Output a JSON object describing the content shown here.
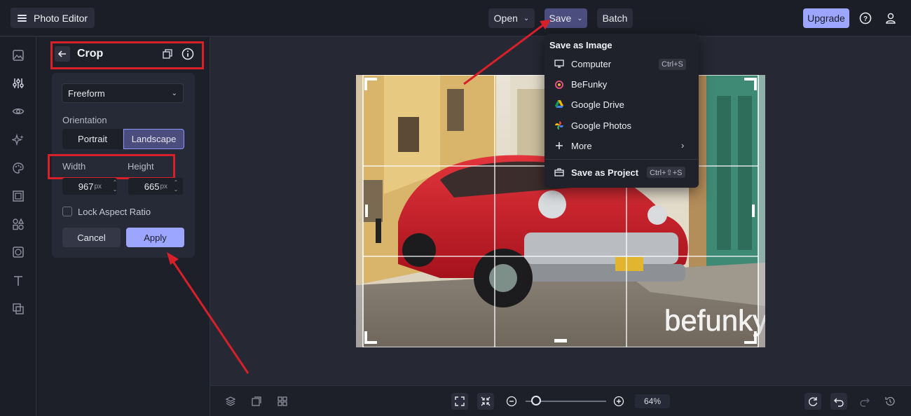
{
  "app": {
    "title": "Photo Editor"
  },
  "toolbar": {
    "open_label": "Open",
    "save_label": "Save",
    "batch_label": "Batch",
    "upgrade_label": "Upgrade"
  },
  "sidebar": {
    "icons": [
      "image-icon",
      "sliders-icon",
      "eye-icon",
      "sparkles-icon",
      "palette-icon",
      "frame-icon",
      "shapes-icon",
      "texture-icon",
      "text-icon",
      "layers-icon"
    ]
  },
  "crop_panel": {
    "title": "Crop",
    "ratio_selected": "Freeform",
    "orientation_label": "Orientation",
    "portrait_label": "Portrait",
    "landscape_label": "Landscape",
    "width_label": "Width",
    "height_label": "Height",
    "width_value": "967",
    "height_value": "665",
    "unit": "px",
    "lock_label": "Lock Aspect Ratio",
    "lock_checked": false,
    "cancel_label": "Cancel",
    "apply_label": "Apply"
  },
  "save_menu": {
    "title": "Save as Image",
    "items": [
      {
        "label": "Computer",
        "shortcut": "Ctrl+S",
        "icon": "monitor-icon"
      },
      {
        "label": "BeFunky",
        "shortcut": "",
        "icon": "befunky-icon"
      },
      {
        "label": "Google Drive",
        "shortcut": "",
        "icon": "google-drive-icon"
      },
      {
        "label": "Google Photos",
        "shortcut": "",
        "icon": "google-photos-icon"
      },
      {
        "label": "More",
        "shortcut": "",
        "icon": "plus-icon"
      }
    ],
    "project": {
      "label": "Save as Project",
      "shortcut": "Ctrl+⇧+S"
    }
  },
  "canvas": {
    "watermark": "befunky"
  },
  "bottom": {
    "zoom": "64%",
    "zoom_fraction": 0.12
  },
  "colors": {
    "accent": "#9da6ff",
    "annotation": "#d8202a",
    "bg": "#262833"
  }
}
